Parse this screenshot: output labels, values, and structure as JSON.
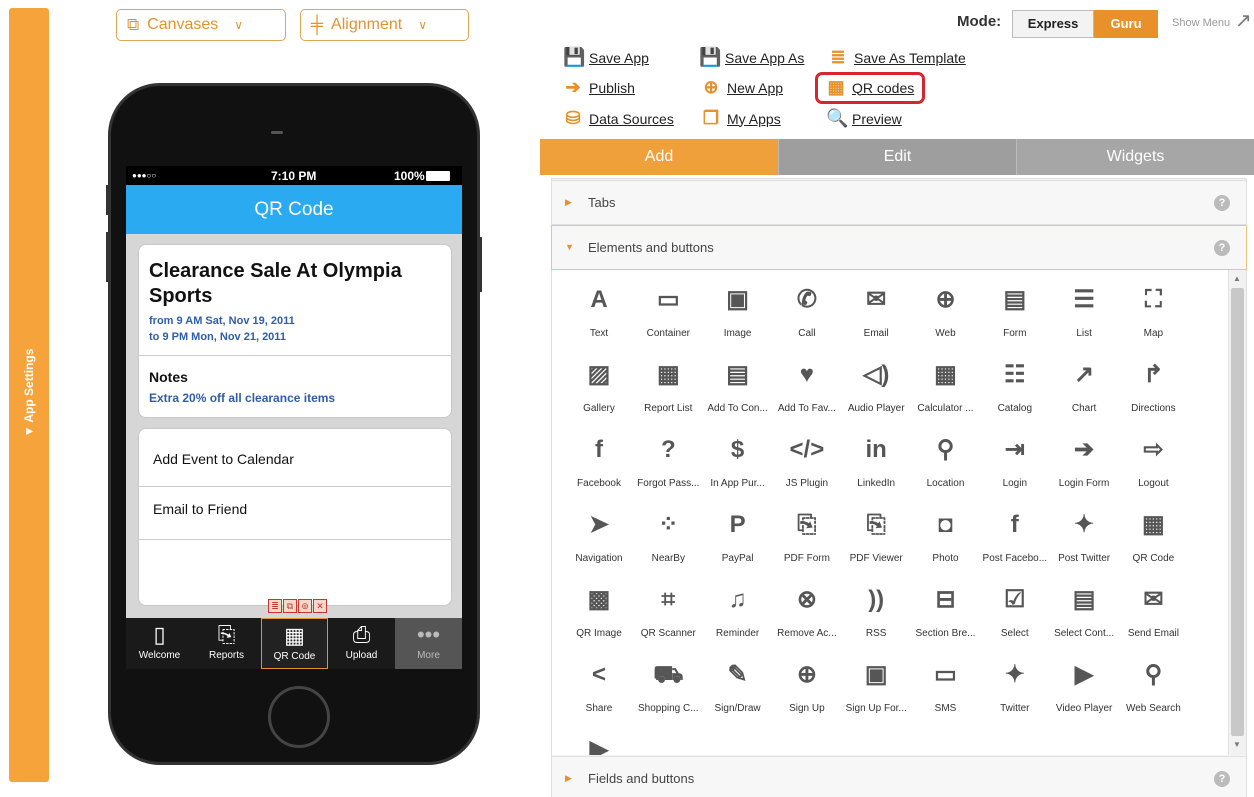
{
  "app_settings": {
    "label": "▼ App Settings"
  },
  "toolbar": {
    "canvases": {
      "icon": "⧉",
      "label": "Canvases",
      "chevron": "∨"
    },
    "alignment": {
      "icon": "╪",
      "label": "Alignment",
      "chevron": "∨"
    }
  },
  "mode": {
    "label": "Mode:",
    "express": "Express",
    "guru": "Guru",
    "show_menu": "Show Menu",
    "show_menu_icon": "↗"
  },
  "actions": {
    "save_app": {
      "icon": "💾",
      "label": "Save App"
    },
    "save_app_as": {
      "icon": "💾",
      "label": "Save App As"
    },
    "save_as_template": {
      "icon": "≣",
      "label": "Save As Template"
    },
    "publish": {
      "icon": "➔",
      "label": "Publish"
    },
    "new_app": {
      "icon": "⊕",
      "label": "New App"
    },
    "qr_codes": {
      "icon": "▦",
      "label": "QR codes"
    },
    "data_sources": {
      "icon": "⛁",
      "label": "Data Sources"
    },
    "my_apps": {
      "icon": "❐",
      "label": "My Apps"
    },
    "preview": {
      "icon": "🔍",
      "label": "Preview"
    }
  },
  "tabs": {
    "add": "Add",
    "edit": "Edit",
    "widgets": "Widgets"
  },
  "accordion": {
    "tabs": {
      "arrow": "▶",
      "title": "Tabs",
      "help": "?"
    },
    "elements": {
      "arrow": "▼",
      "title": "Elements and buttons",
      "help": "?"
    },
    "fields": {
      "arrow": "▶",
      "title": "Fields and buttons",
      "help": "?"
    }
  },
  "scroll": {
    "up": "▲",
    "down": "▼"
  },
  "widgets": [
    {
      "icon": "A",
      "label": "Text"
    },
    {
      "icon": "▭",
      "label": "Container"
    },
    {
      "icon": "▣",
      "label": "Image"
    },
    {
      "icon": "✆",
      "label": "Call"
    },
    {
      "icon": "✉",
      "label": "Email"
    },
    {
      "icon": "⊕",
      "label": "Web"
    },
    {
      "icon": "▤",
      "label": "Form"
    },
    {
      "icon": "☰",
      "label": "List"
    },
    {
      "icon": "⛶",
      "label": "Map"
    },
    {
      "icon": "▨",
      "label": "Gallery"
    },
    {
      "icon": "▦",
      "label": "Report List"
    },
    {
      "icon": "▤",
      "label": "Add To Con..."
    },
    {
      "icon": "♥",
      "label": "Add To Fav..."
    },
    {
      "icon": "◁)",
      "label": "Audio Player"
    },
    {
      "icon": "▦",
      "label": "Calculator ..."
    },
    {
      "icon": "☷",
      "label": "Catalog"
    },
    {
      "icon": "↗",
      "label": "Chart"
    },
    {
      "icon": "↱",
      "label": "Directions"
    },
    {
      "icon": "f",
      "label": "Facebook"
    },
    {
      "icon": "?",
      "label": "Forgot Pass..."
    },
    {
      "icon": "$",
      "label": "In App Pur..."
    },
    {
      "icon": "</>",
      "label": "JS Plugin"
    },
    {
      "icon": "in",
      "label": "LinkedIn"
    },
    {
      "icon": "⚲",
      "label": "Location"
    },
    {
      "icon": "⇥",
      "label": "Login"
    },
    {
      "icon": "➔",
      "label": "Login Form"
    },
    {
      "icon": "⇨",
      "label": "Logout"
    },
    {
      "icon": "➤",
      "label": "Navigation"
    },
    {
      "icon": "⁘",
      "label": "NearBy"
    },
    {
      "icon": "P",
      "label": "PayPal"
    },
    {
      "icon": "⎘",
      "label": "PDF Form"
    },
    {
      "icon": "⎘",
      "label": "PDF Viewer"
    },
    {
      "icon": "◘",
      "label": "Photo"
    },
    {
      "icon": "f",
      "label": "Post Facebo..."
    },
    {
      "icon": "✦",
      "label": "Post Twitter"
    },
    {
      "icon": "▦",
      "label": "QR Code"
    },
    {
      "icon": "▩",
      "label": "QR Image"
    },
    {
      "icon": "⌗",
      "label": "QR Scanner"
    },
    {
      "icon": "♫",
      "label": "Reminder"
    },
    {
      "icon": "⊗",
      "label": "Remove Ac..."
    },
    {
      "icon": "))",
      "label": "RSS"
    },
    {
      "icon": "⊟",
      "label": "Section Bre..."
    },
    {
      "icon": "☑",
      "label": "Select"
    },
    {
      "icon": "▤",
      "label": "Select Cont..."
    },
    {
      "icon": "✉",
      "label": "Send Email"
    },
    {
      "icon": "<",
      "label": "Share"
    },
    {
      "icon": "⛟",
      "label": "Shopping C..."
    },
    {
      "icon": "✎",
      "label": "Sign/Draw"
    },
    {
      "icon": "⊕",
      "label": "Sign Up"
    },
    {
      "icon": "▣",
      "label": "Sign Up For..."
    },
    {
      "icon": "▭",
      "label": "SMS"
    },
    {
      "icon": "✦",
      "label": "Twitter"
    },
    {
      "icon": "▶",
      "label": "Video Player"
    },
    {
      "icon": "⚲",
      "label": "Web Search"
    },
    {
      "icon": "▶",
      "label": ""
    }
  ],
  "phone": {
    "status": {
      "signal": "●●●○○",
      "time": "7:10 PM",
      "battery": "100%"
    },
    "nav_title": "QR Code",
    "event": {
      "title": "Clearance Sale At Olympia Sports",
      "from": "from 9 AM Sat, Nov 19, 2011",
      "to": "to 9 PM Mon, Nov 21, 2011",
      "notes_title": "Notes",
      "notes_text": "Extra 20% off all clearance items"
    },
    "rows": {
      "calendar": "Add Event to Calendar",
      "email": "Email to Friend"
    },
    "mini_toolbar": [
      "≣",
      "⧉",
      "⊚",
      "✕"
    ],
    "tabbar": [
      {
        "icon": "▯",
        "label": "Welcome"
      },
      {
        "icon": "⎘",
        "label": "Reports"
      },
      {
        "icon": "▦",
        "label": "QR Code"
      },
      {
        "icon": "⎙",
        "label": "Upload"
      },
      {
        "icon": "•••",
        "label": "More"
      }
    ]
  }
}
